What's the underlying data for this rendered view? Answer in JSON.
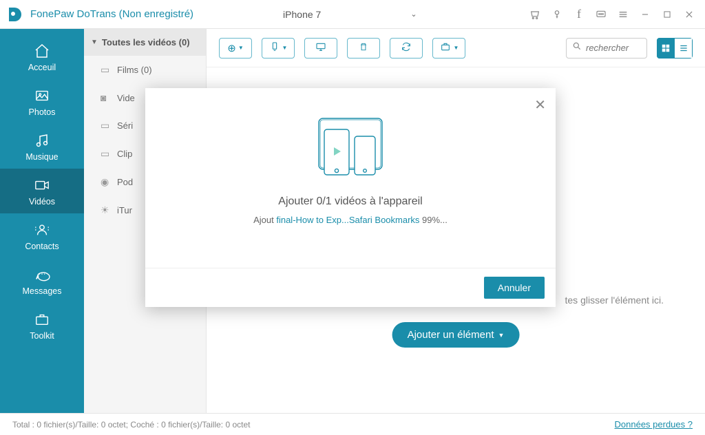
{
  "app": {
    "title": "FonePaw DoTrans (Non enregistré)",
    "device": "iPhone 7"
  },
  "sidebar": {
    "items": [
      {
        "label": "Acceuil"
      },
      {
        "label": "Photos"
      },
      {
        "label": "Musique"
      },
      {
        "label": "Vidéos"
      },
      {
        "label": "Contacts"
      },
      {
        "label": "Messages"
      },
      {
        "label": "Toolkit"
      }
    ]
  },
  "category": {
    "header": "Toutes les vidéos (0)",
    "items": [
      {
        "label": "Films (0)"
      },
      {
        "label": "Vide"
      },
      {
        "label": "Séri"
      },
      {
        "label": "Clip"
      },
      {
        "label": "Pod"
      },
      {
        "label": "iTur"
      }
    ]
  },
  "toolbar": {
    "search_placeholder": "rechercher"
  },
  "content": {
    "drop_hint": "tes glisser l'élément ici.",
    "add_button": "Ajouter un élément"
  },
  "footer": {
    "status": "Total : 0 fichier(s)/Taille: 0 octet; Coché : 0 fichier(s)/Taille: 0 octet",
    "lost_data": "Données perdues ?"
  },
  "modal": {
    "title": "Ajouter 0/1 vidéos à l'appareil",
    "progress_prefix": "Ajout ",
    "progress_file": "final-How to Exp...Safari Bookmarks",
    "progress_suffix": " 99%...",
    "cancel": "Annuler"
  }
}
